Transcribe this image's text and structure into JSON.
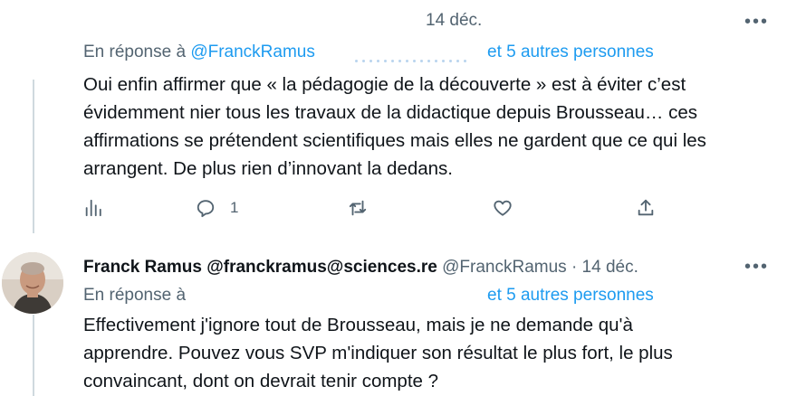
{
  "tweet1": {
    "date": "14 déc.",
    "reply_prefix": "En réponse à",
    "reply_handle": "@FranckRamus",
    "reply_others": "et 5 autres personnes",
    "text_lines": [
      "Oui enfin affirmer que « la pédagogie de la découverte » est à éviter c’est",
      "évidemment nier tous les travaux de la didactique depuis Brousseau… ces",
      "affirmations se prétendent scientifiques mais elles ne gardent que ce qui les",
      "arrangent. De plus rien d’innovant la dedans."
    ],
    "reply_count": "1",
    "more": "•••"
  },
  "tweet2": {
    "author_name": "Franck Ramus @franckramus@sciences.re",
    "author_handle": "@FranckRamus · 14 déc.",
    "reply_prefix": "En réponse à",
    "reply_others": "et 5 autres personnes",
    "text_lines": [
      "Effectivement j'ignore tout de Brousseau, mais je ne demande qu'à",
      "apprendre. Pouvez vous SVP m'indiquer son résultat le plus fort, le plus",
      "convaincant, dont on devrait tenir compte ?"
    ],
    "more": "•••"
  },
  "icons": [
    "analytics-icon",
    "reply-icon",
    "retweet-icon",
    "like-icon",
    "share-icon",
    "more-icon"
  ],
  "colors": {
    "link": "#1d9bf0",
    "muted": "#536471",
    "text": "#0f1419",
    "thread": "#cfd9de"
  }
}
